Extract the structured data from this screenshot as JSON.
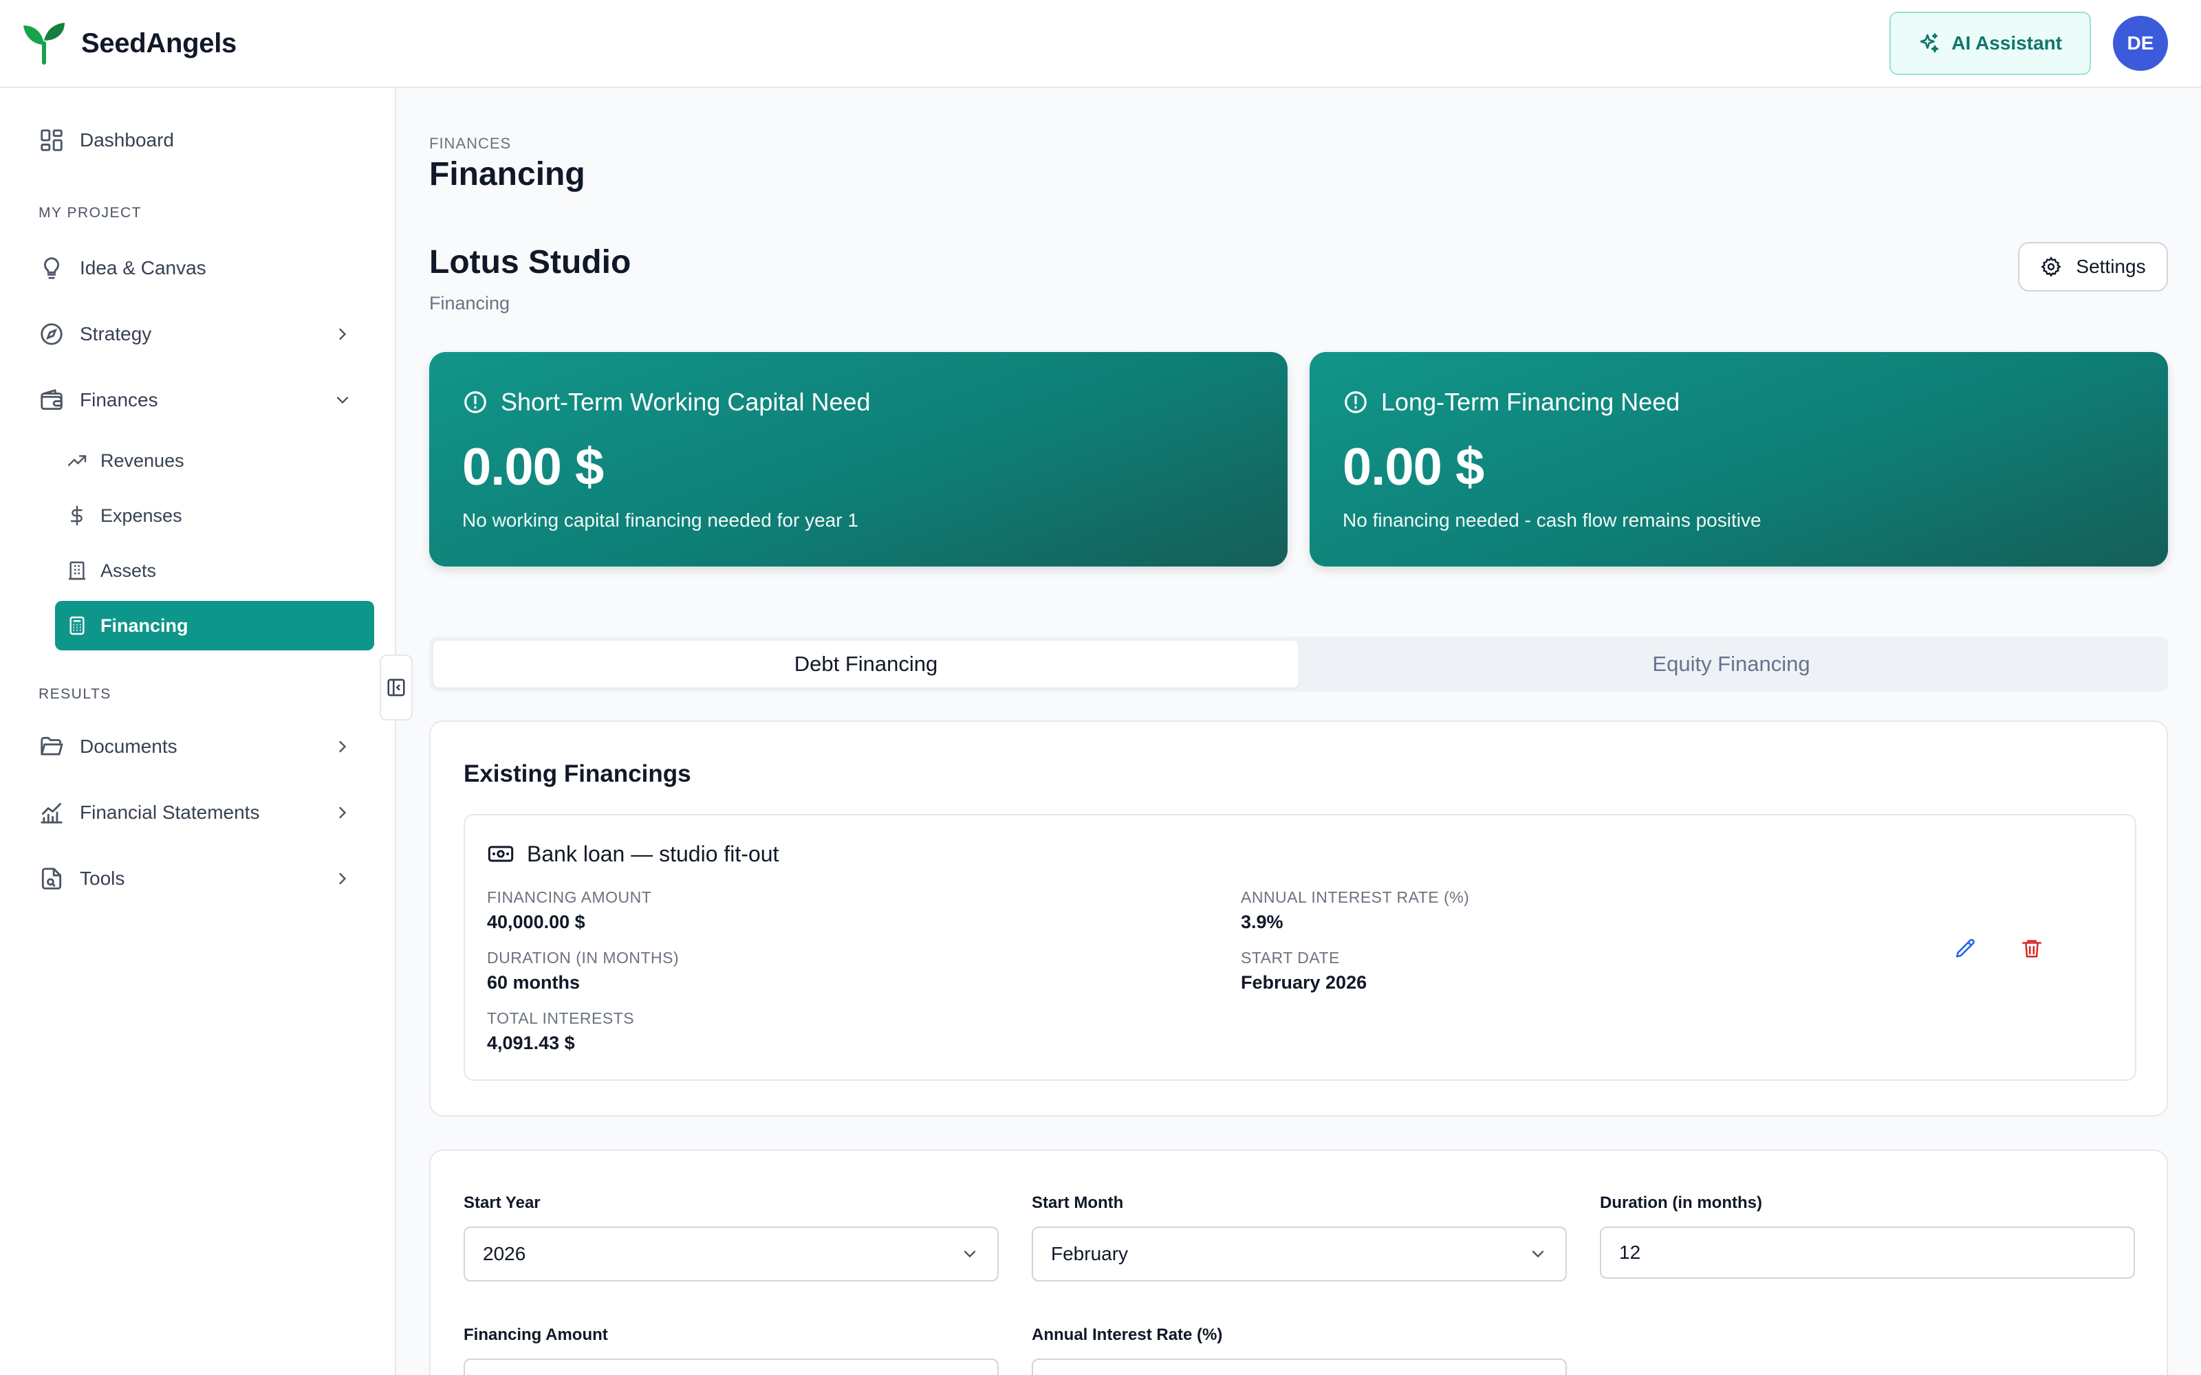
{
  "app": {
    "brand": "SeedAngels",
    "ai_button": "AI Assistant",
    "avatar_initials": "DE"
  },
  "sidebar": {
    "dashboard": "Dashboard",
    "my_project_label": "MY PROJECT",
    "idea": "Idea & Canvas",
    "strategy": "Strategy",
    "finances": "Finances",
    "revenues": "Revenues",
    "expenses": "Expenses",
    "assets": "Assets",
    "financing": "Financing",
    "results_label": "RESULTS",
    "documents": "Documents",
    "statements": "Financial Statements",
    "tools": "Tools"
  },
  "page": {
    "eyebrow": "FINANCES",
    "title": "Financing",
    "project_name": "Lotus Studio",
    "project_sub": "Financing",
    "settings": "Settings"
  },
  "cards": [
    {
      "title": "Short-Term Working Capital Need",
      "value": "0.00 $",
      "note": "No working capital financing needed for year 1"
    },
    {
      "title": "Long-Term Financing Need",
      "value": "0.00 $",
      "note": "No financing needed - cash flow remains positive"
    }
  ],
  "tabs": {
    "debt": "Debt Financing",
    "equity": "Equity Financing"
  },
  "existing": {
    "title": "Existing Financings",
    "name": "Bank loan — studio fit-out",
    "amount_label": "FINANCING AMOUNT",
    "amount": "40,000.00 $",
    "duration_label": "DURATION (IN MONTHS)",
    "duration": "60 months",
    "interests_label": "TOTAL INTERESTS",
    "interests": "4,091.43 $",
    "rate_label": "ANNUAL INTEREST RATE (%)",
    "rate": "3.9%",
    "start_label": "START DATE",
    "start": "February 2026"
  },
  "form": {
    "start_year_label": "Start Year",
    "start_year": "2026",
    "start_month_label": "Start Month",
    "start_month": "February",
    "duration_label": "Duration (in months)",
    "duration": "12",
    "amount_label": "Financing Amount",
    "rate_label": "Annual Interest Rate (%)"
  },
  "colors": {
    "accent": "#0f968a",
    "avatar": "#3b5bdb",
    "danger": "#dc2626",
    "edit": "#2563eb"
  }
}
